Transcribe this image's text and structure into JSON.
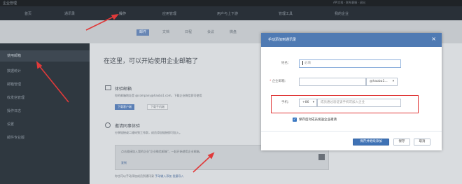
{
  "colors": {
    "annotation_red": "#e03a3a",
    "dialog_header": "#4f7ab3",
    "primary_button": "#3f72b5",
    "checkbox": "#3a78c2"
  },
  "topbar": {
    "logo": "企业管理",
    "right_text": "API文档 · 联系客服 · 退出"
  },
  "nav": {
    "items": [
      "首页",
      "通讯录",
      "操作",
      "应用管理",
      "用户与上下游",
      "管理工具",
      "我的企业"
    ]
  },
  "subnav": {
    "tabs": [
      "邮件",
      "文档",
      "日程",
      "会议",
      "微盘"
    ]
  },
  "sidebar": {
    "items": [
      "使用邮箱",
      "数据统计",
      "邮箱管理",
      "收发信管理",
      "操作日志",
      "设置",
      "邮件专业版"
    ]
  },
  "content": {
    "title": "在这里，可以开始使用企业邮箱了",
    "mail_heading": "体验邮箱",
    "mail_desc": "你的邮箱地址是 @company@haoba1.com，下载企业微信即可使用",
    "mail_btn_primary": "下载客户端",
    "mail_btn_plain": "下载手机端",
    "invite_heading": "邀请同事体验",
    "invite_desc": "分享链接或二维码到工作群，成员添加链接即可加入。",
    "invite_box_line1": "点击链接加入我的企业\"企业微信邮箱\"，一起开始使用企业邮箱。",
    "invite_box_line2": "复制",
    "bottom_prefix": "你也可以手动添加成员到通讯录",
    "bottom_link1": "手动输入添加",
    "bottom_link2": "批量导入"
  },
  "dialog": {
    "title": "手动添加到通讯录",
    "close_glyph": "×",
    "name_label": "姓名：",
    "name_placeholder": "必填",
    "email_label": "企业邮箱：",
    "email_required_mark": "*",
    "email_value": "",
    "email_domain": "@haoba1...",
    "email_domain_arrow": "▾",
    "phone_label": "手机：",
    "phone_prefix": "+86",
    "phone_prefix_arrow": "▾",
    "phone_placeholder": "成员通过验证该手机可加入企业",
    "checkbox_checked": true,
    "checkbox_mark": "✓",
    "checkbox_label": "保存后对成员发送企业邀请",
    "btn_save_continue": "保存并继续添加",
    "btn_save": "保存",
    "btn_cancel": "取消"
  }
}
